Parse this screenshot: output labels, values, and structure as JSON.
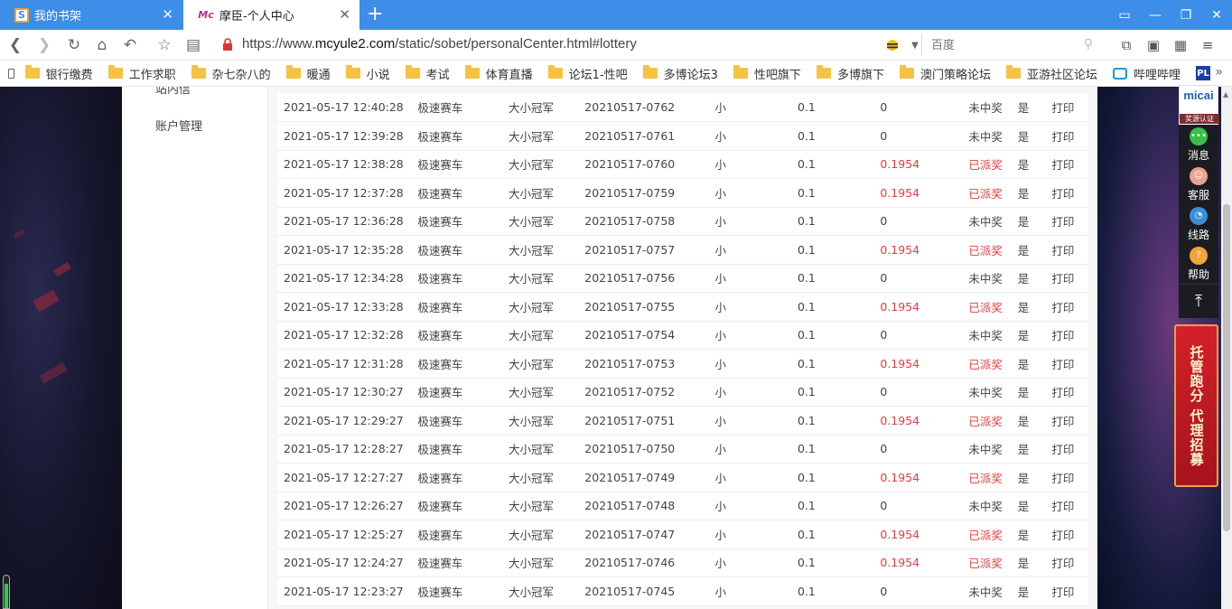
{
  "tabs": [
    {
      "title": "我的书架",
      "icon": "bookshelf-icon"
    },
    {
      "title": "摩臣-个人中心",
      "icon": "mc-logo-icon"
    }
  ],
  "address": {
    "url_prefix": "https://www.",
    "url_host": "mcyule2.com",
    "url_path": "/static/sobet/personalCenter.html#lottery"
  },
  "search": {
    "placeholder": "百度"
  },
  "bookmarks": [
    "银行缴费",
    "工作求职",
    "杂七杂八的",
    "暖通",
    "小说",
    "考试",
    "体育直播",
    "论坛1-性吧",
    "多博论坛3",
    "性吧旗下",
    "多博旗下",
    "澳门策略论坛",
    "亚游社区论坛",
    "哔哩哔哩"
  ],
  "sidebar": {
    "clipped_item": "站内信",
    "account_mgmt": "账户管理"
  },
  "rows": [
    {
      "time": "2021-05-17 12:40:28",
      "game": "极速赛车",
      "play": "大小冠军",
      "issue": "20210517-0762",
      "bet": "小",
      "amount": "0.1",
      "win": "0",
      "status": "未中奖",
      "flag": "是",
      "action": "打印",
      "won": false
    },
    {
      "time": "2021-05-17 12:39:28",
      "game": "极速赛车",
      "play": "大小冠军",
      "issue": "20210517-0761",
      "bet": "小",
      "amount": "0.1",
      "win": "0",
      "status": "未中奖",
      "flag": "是",
      "action": "打印",
      "won": false
    },
    {
      "time": "2021-05-17 12:38:28",
      "game": "极速赛车",
      "play": "大小冠军",
      "issue": "20210517-0760",
      "bet": "小",
      "amount": "0.1",
      "win": "0.1954",
      "status": "已派奖",
      "flag": "是",
      "action": "打印",
      "won": true
    },
    {
      "time": "2021-05-17 12:37:28",
      "game": "极速赛车",
      "play": "大小冠军",
      "issue": "20210517-0759",
      "bet": "小",
      "amount": "0.1",
      "win": "0.1954",
      "status": "已派奖",
      "flag": "是",
      "action": "打印",
      "won": true
    },
    {
      "time": "2021-05-17 12:36:28",
      "game": "极速赛车",
      "play": "大小冠军",
      "issue": "20210517-0758",
      "bet": "小",
      "amount": "0.1",
      "win": "0",
      "status": "未中奖",
      "flag": "是",
      "action": "打印",
      "won": false
    },
    {
      "time": "2021-05-17 12:35:28",
      "game": "极速赛车",
      "play": "大小冠军",
      "issue": "20210517-0757",
      "bet": "小",
      "amount": "0.1",
      "win": "0.1954",
      "status": "已派奖",
      "flag": "是",
      "action": "打印",
      "won": true
    },
    {
      "time": "2021-05-17 12:34:28",
      "game": "极速赛车",
      "play": "大小冠军",
      "issue": "20210517-0756",
      "bet": "小",
      "amount": "0.1",
      "win": "0",
      "status": "未中奖",
      "flag": "是",
      "action": "打印",
      "won": false
    },
    {
      "time": "2021-05-17 12:33:28",
      "game": "极速赛车",
      "play": "大小冠军",
      "issue": "20210517-0755",
      "bet": "小",
      "amount": "0.1",
      "win": "0.1954",
      "status": "已派奖",
      "flag": "是",
      "action": "打印",
      "won": true
    },
    {
      "time": "2021-05-17 12:32:28",
      "game": "极速赛车",
      "play": "大小冠军",
      "issue": "20210517-0754",
      "bet": "小",
      "amount": "0.1",
      "win": "0",
      "status": "未中奖",
      "flag": "是",
      "action": "打印",
      "won": false
    },
    {
      "time": "2021-05-17 12:31:28",
      "game": "极速赛车",
      "play": "大小冠军",
      "issue": "20210517-0753",
      "bet": "小",
      "amount": "0.1",
      "win": "0.1954",
      "status": "已派奖",
      "flag": "是",
      "action": "打印",
      "won": true
    },
    {
      "time": "2021-05-17 12:30:27",
      "game": "极速赛车",
      "play": "大小冠军",
      "issue": "20210517-0752",
      "bet": "小",
      "amount": "0.1",
      "win": "0",
      "status": "未中奖",
      "flag": "是",
      "action": "打印",
      "won": false
    },
    {
      "time": "2021-05-17 12:29:27",
      "game": "极速赛车",
      "play": "大小冠军",
      "issue": "20210517-0751",
      "bet": "小",
      "amount": "0.1",
      "win": "0.1954",
      "status": "已派奖",
      "flag": "是",
      "action": "打印",
      "won": true
    },
    {
      "time": "2021-05-17 12:28:27",
      "game": "极速赛车",
      "play": "大小冠军",
      "issue": "20210517-0750",
      "bet": "小",
      "amount": "0.1",
      "win": "0",
      "status": "未中奖",
      "flag": "是",
      "action": "打印",
      "won": false
    },
    {
      "time": "2021-05-17 12:27:27",
      "game": "极速赛车",
      "play": "大小冠军",
      "issue": "20210517-0749",
      "bet": "小",
      "amount": "0.1",
      "win": "0.1954",
      "status": "已派奖",
      "flag": "是",
      "action": "打印",
      "won": true
    },
    {
      "time": "2021-05-17 12:26:27",
      "game": "极速赛车",
      "play": "大小冠军",
      "issue": "20210517-0748",
      "bet": "小",
      "amount": "0.1",
      "win": "0",
      "status": "未中奖",
      "flag": "是",
      "action": "打印",
      "won": false
    },
    {
      "time": "2021-05-17 12:25:27",
      "game": "极速赛车",
      "play": "大小冠军",
      "issue": "20210517-0747",
      "bet": "小",
      "amount": "0.1",
      "win": "0.1954",
      "status": "已派奖",
      "flag": "是",
      "action": "打印",
      "won": true
    },
    {
      "time": "2021-05-17 12:24:27",
      "game": "极速赛车",
      "play": "大小冠军",
      "issue": "20210517-0746",
      "bet": "小",
      "amount": "0.1",
      "win": "0.1954",
      "status": "已派奖",
      "flag": "是",
      "action": "打印",
      "won": true
    },
    {
      "time": "2021-05-17 12:23:27",
      "game": "极速赛车",
      "play": "大小冠军",
      "issue": "20210517-0745",
      "bet": "小",
      "amount": "0.1",
      "win": "0",
      "status": "未中奖",
      "flag": "是",
      "action": "打印",
      "won": false
    }
  ],
  "float_panel": {
    "badge_logo": "micai",
    "badge_cert": "奖源认证",
    "items": [
      {
        "label": "消息",
        "icon": "message-icon",
        "color": "#3bbf4a"
      },
      {
        "label": "客服",
        "icon": "customer-service-icon",
        "color": "#e6a48a"
      },
      {
        "label": "线路",
        "icon": "route-icon",
        "color": "#3a8fd8"
      },
      {
        "label": "帮助",
        "icon": "help-icon",
        "color": "#f2a33a"
      }
    ],
    "to_top_icon": "back-to-top-icon"
  },
  "banner": {
    "text": "托管跑分 代理招募"
  },
  "colors": {
    "tab_bar": "#3d8ee8",
    "win_text": "#e23d3d"
  },
  "loading_progress": 0.75
}
